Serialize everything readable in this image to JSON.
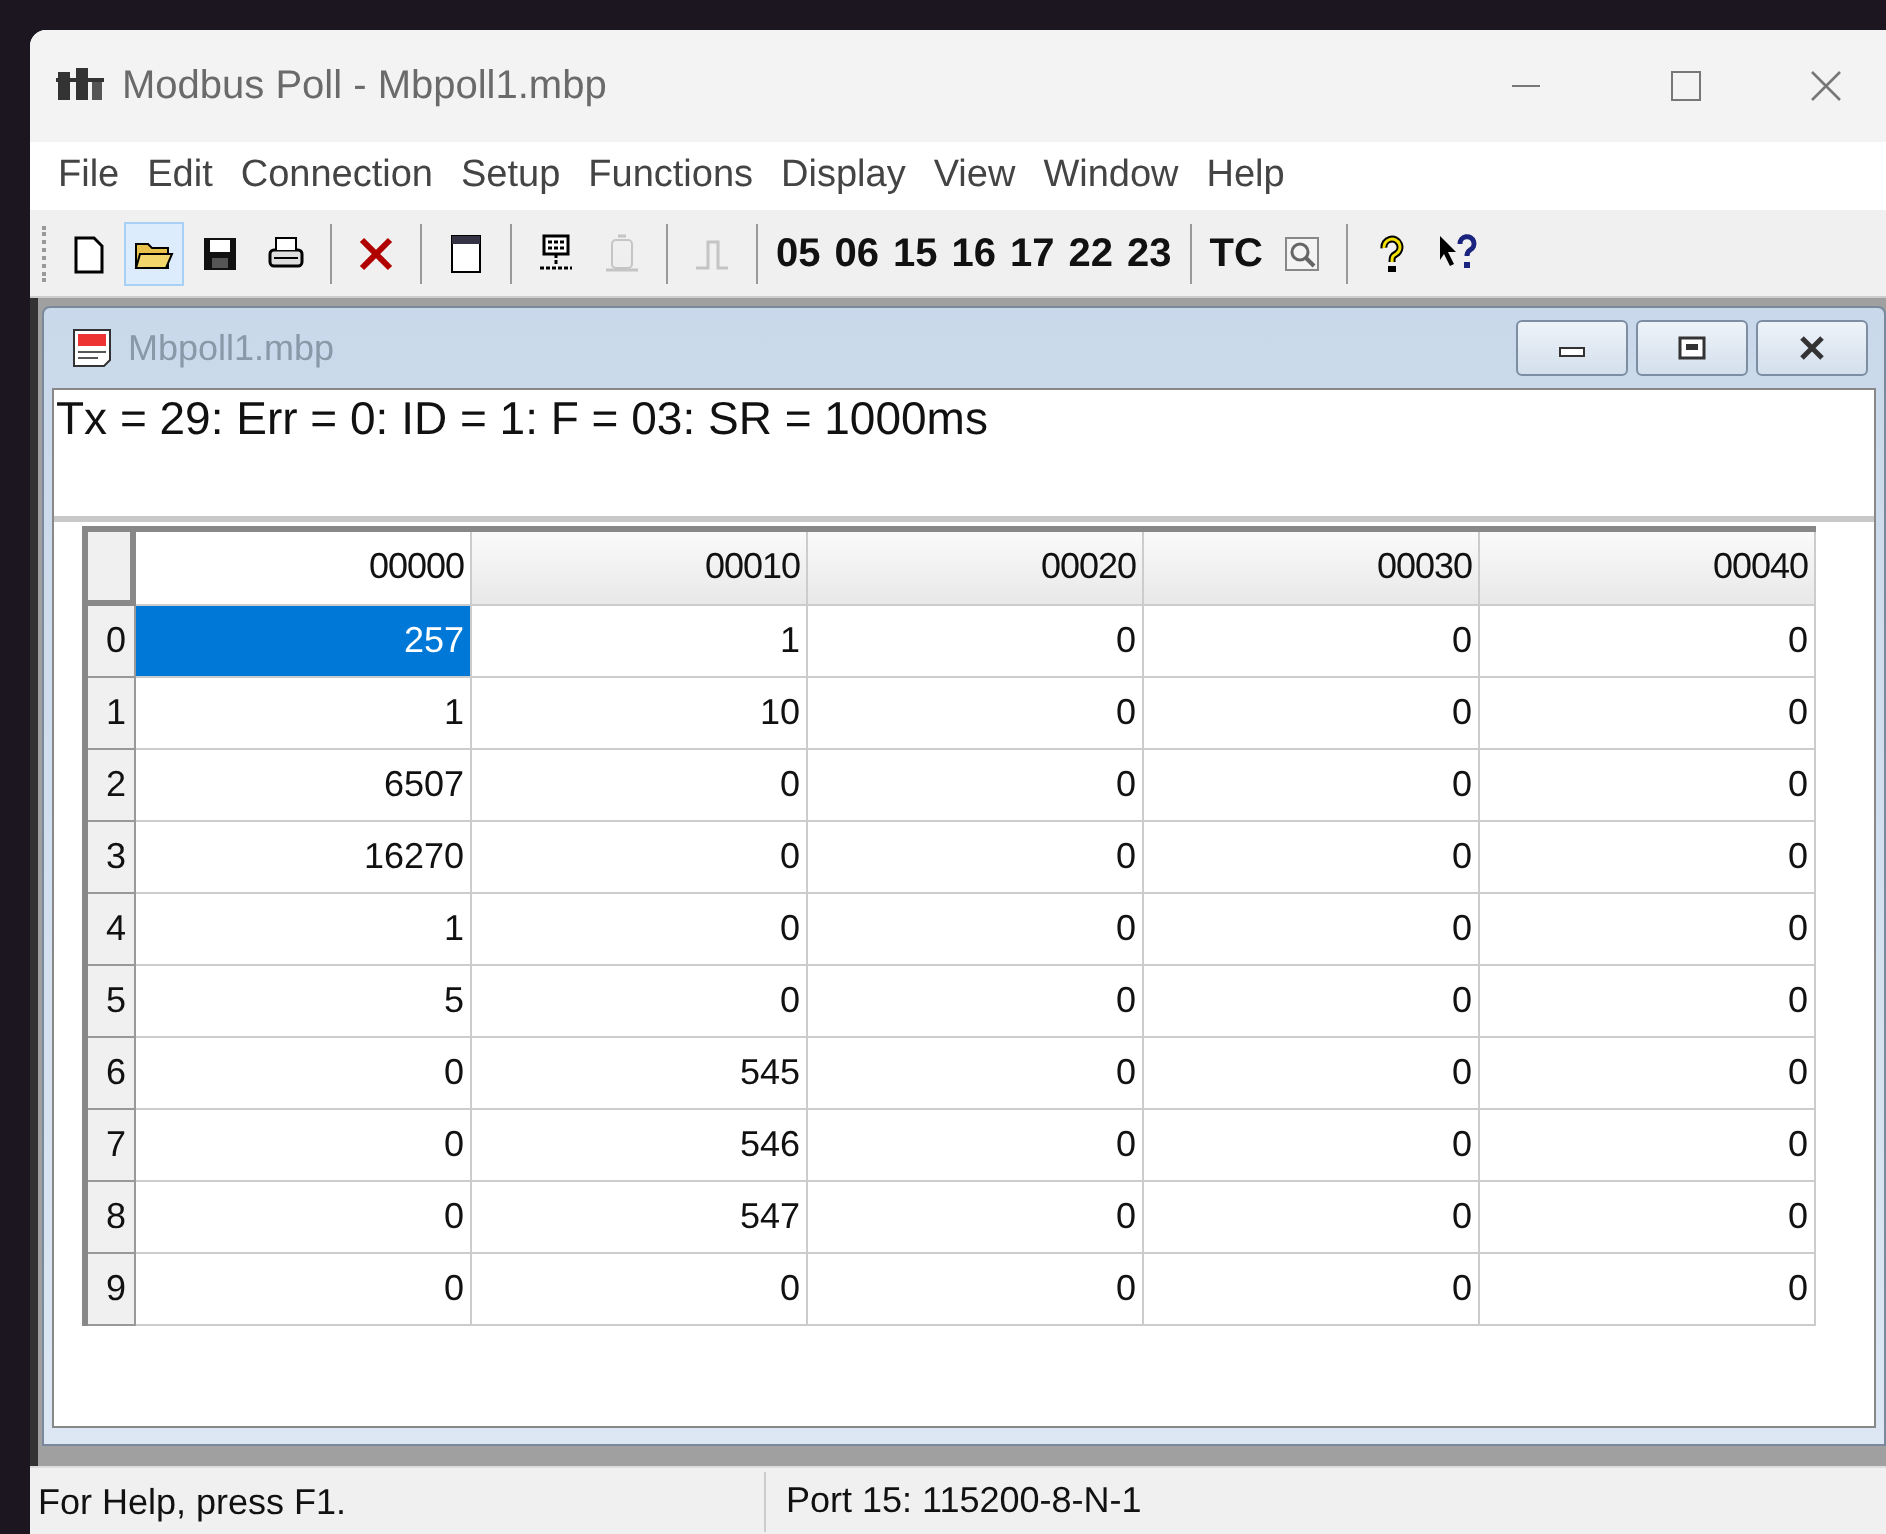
{
  "window": {
    "title": "Modbus Poll - Mbpoll1.mbp"
  },
  "menu": [
    "File",
    "Edit",
    "Connection",
    "Setup",
    "Functions",
    "Display",
    "View",
    "Window",
    "Help"
  ],
  "toolbar": [
    {
      "kind": "icon",
      "disabled": false,
      "highlighted": false
    },
    {
      "kind": "icon",
      "disabled": false,
      "highlighted": true
    },
    {
      "kind": "icon",
      "disabled": false,
      "highlighted": false
    },
    {
      "kind": "icon",
      "disabled": false,
      "highlighted": false
    },
    {
      "kind": "separator"
    },
    {
      "kind": "icon",
      "disabled": false,
      "highlighted": false
    },
    {
      "kind": "separator"
    },
    {
      "kind": "icon",
      "disabled": false,
      "highlighted": false
    },
    {
      "kind": "separator"
    },
    {
      "kind": "icon",
      "disabled": false,
      "highlighted": false
    },
    {
      "kind": "icon",
      "disabled": true,
      "highlighted": false
    },
    {
      "kind": "separator"
    },
    {
      "kind": "icon",
      "disabled": true,
      "highlighted": false
    },
    {
      "kind": "separator"
    },
    {
      "kind": "text",
      "label": "05"
    },
    {
      "kind": "text",
      "label": "06"
    },
    {
      "kind": "text",
      "label": "15"
    },
    {
      "kind": "text",
      "label": "16"
    },
    {
      "kind": "text",
      "label": "17"
    },
    {
      "kind": "text",
      "label": "22"
    },
    {
      "kind": "text",
      "label": "23"
    },
    {
      "kind": "separator"
    },
    {
      "kind": "text",
      "label": "TC"
    },
    {
      "kind": "icon",
      "disabled": false,
      "highlighted": false
    },
    {
      "kind": "separator"
    },
    {
      "kind": "icon",
      "disabled": false,
      "highlighted": false
    },
    {
      "kind": "icon",
      "disabled": false,
      "highlighted": false
    }
  ],
  "child": {
    "title": "Mbpoll1.mbp",
    "info": "Tx = 29: Err = 0: ID = 1: F = 03: SR = 1000ms",
    "table": {
      "columns": [
        "00000",
        "00010",
        "00020",
        "00030",
        "00040"
      ],
      "rows": [
        {
          "label": "0",
          "cells": [
            "257",
            "1",
            "0",
            "0",
            "0"
          ],
          "selected": [
            true,
            false,
            false,
            false,
            false
          ]
        },
        {
          "label": "1",
          "cells": [
            "1",
            "10",
            "0",
            "0",
            "0"
          ],
          "selected": [
            false,
            false,
            false,
            false,
            false
          ]
        },
        {
          "label": "2",
          "cells": [
            "6507",
            "0",
            "0",
            "0",
            "0"
          ],
          "selected": [
            false,
            false,
            false,
            false,
            false
          ]
        },
        {
          "label": "3",
          "cells": [
            "16270",
            "0",
            "0",
            "0",
            "0"
          ],
          "selected": [
            false,
            false,
            false,
            false,
            false
          ]
        },
        {
          "label": "4",
          "cells": [
            "1",
            "0",
            "0",
            "0",
            "0"
          ],
          "selected": [
            false,
            false,
            false,
            false,
            false
          ]
        },
        {
          "label": "5",
          "cells": [
            "5",
            "0",
            "0",
            "0",
            "0"
          ],
          "selected": [
            false,
            false,
            false,
            false,
            false
          ]
        },
        {
          "label": "6",
          "cells": [
            "0",
            "545",
            "0",
            "0",
            "0"
          ],
          "selected": [
            false,
            false,
            false,
            false,
            false
          ]
        },
        {
          "label": "7",
          "cells": [
            "0",
            "546",
            "0",
            "0",
            "0"
          ],
          "selected": [
            false,
            false,
            false,
            false,
            false
          ]
        },
        {
          "label": "8",
          "cells": [
            "0",
            "547",
            "0",
            "0",
            "0"
          ],
          "selected": [
            false,
            false,
            false,
            false,
            false
          ]
        },
        {
          "label": "9",
          "cells": [
            "0",
            "0",
            "0",
            "0",
            "0"
          ],
          "selected": [
            false,
            false,
            false,
            false,
            false
          ]
        }
      ]
    }
  },
  "status_bar": [
    "For Help, press F1.",
    "Port 15: 115200-8-N-1"
  ]
}
